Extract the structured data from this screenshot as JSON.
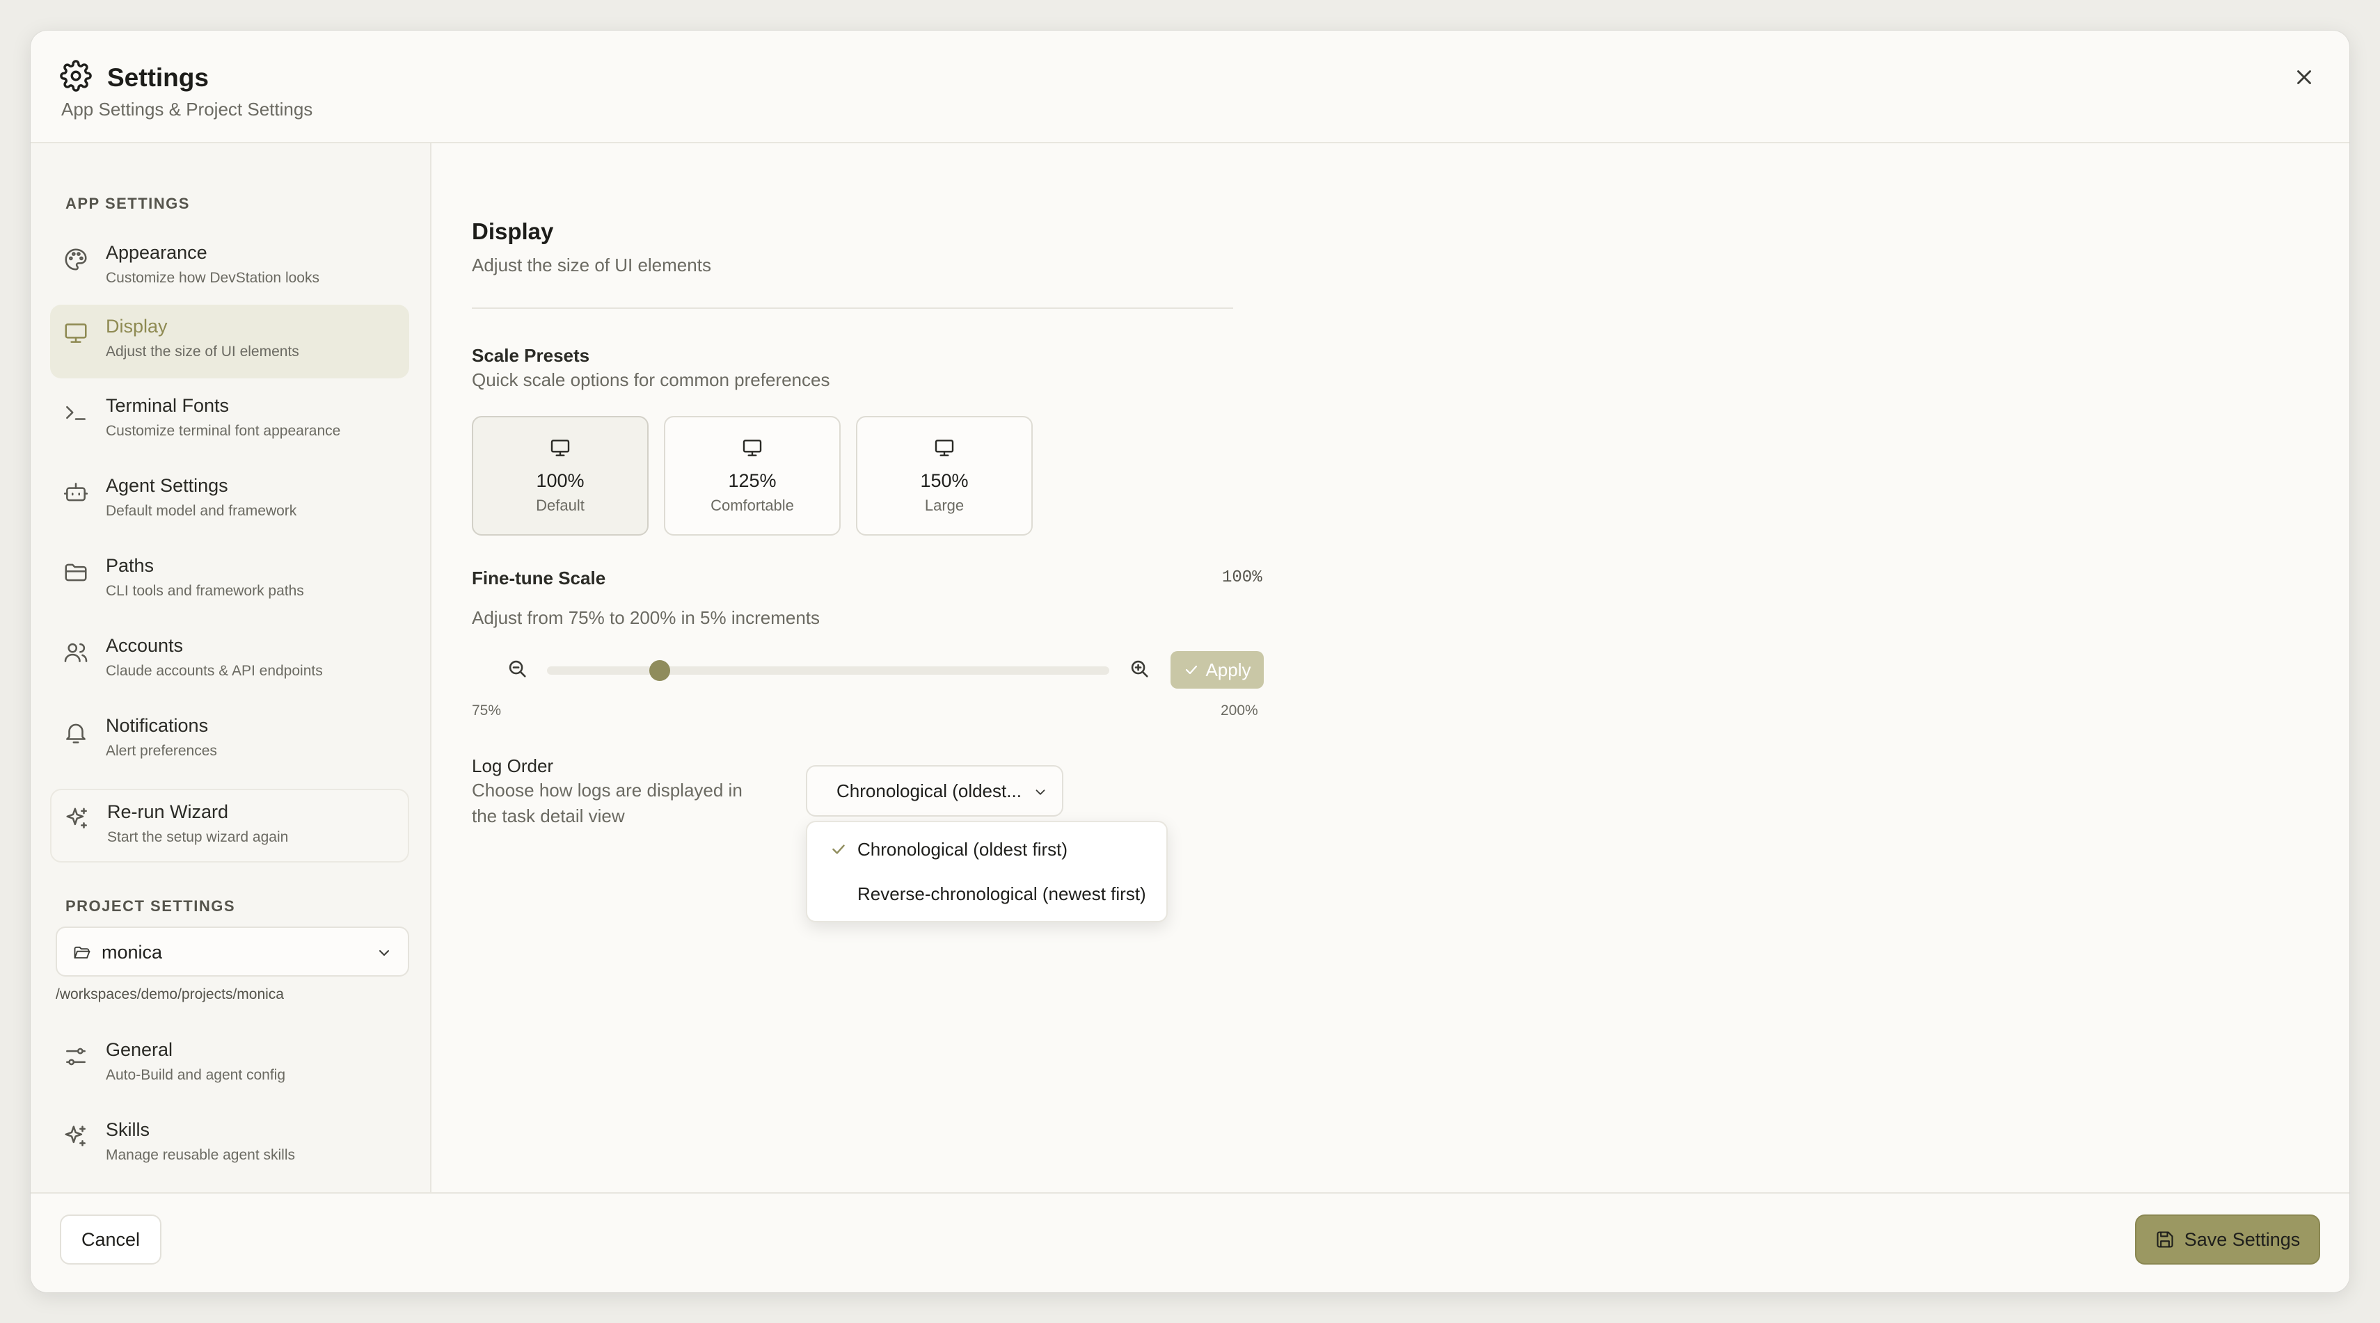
{
  "header": {
    "title": "Settings",
    "subtitle": "App Settings & Project Settings"
  },
  "sidebar": {
    "app_section_label": "APP SETTINGS",
    "items": [
      {
        "label": "Appearance",
        "desc": "Customize how DevStation looks",
        "icon": "palette-icon"
      },
      {
        "label": "Display",
        "desc": "Adjust the size of UI elements",
        "icon": "monitor-icon",
        "active": true
      },
      {
        "label": "Terminal Fonts",
        "desc": "Customize terminal font appearance",
        "icon": "terminal-icon"
      },
      {
        "label": "Agent Settings",
        "desc": "Default model and framework",
        "icon": "bot-icon"
      },
      {
        "label": "Paths",
        "desc": "CLI tools and framework paths",
        "icon": "folder-icon"
      },
      {
        "label": "Accounts",
        "desc": "Claude accounts & API endpoints",
        "icon": "users-icon"
      },
      {
        "label": "Notifications",
        "desc": "Alert preferences",
        "icon": "bell-icon"
      },
      {
        "label": "Re-run Wizard",
        "desc": "Start the setup wizard again",
        "icon": "sparkles-icon"
      }
    ],
    "project_section_label": "PROJECT SETTINGS",
    "project_select": {
      "value": "monica"
    },
    "project_path": "/workspaces/demo/projects/monica",
    "project_items": [
      {
        "label": "General",
        "desc": "Auto-Build and agent config",
        "icon": "sliders-icon"
      },
      {
        "label": "Skills",
        "desc": "Manage reusable agent skills",
        "icon": "sparkles-icon"
      }
    ]
  },
  "main": {
    "title": "Display",
    "subtitle": "Adjust the size of UI elements",
    "scale_presets": {
      "title": "Scale Presets",
      "desc": "Quick scale options for common preferences",
      "options": [
        {
          "value": "100%",
          "label": "Default",
          "selected": true
        },
        {
          "value": "125%",
          "label": "Comfortable"
        },
        {
          "value": "150%",
          "label": "Large"
        }
      ]
    },
    "fine_tune": {
      "title": "Fine-tune Scale",
      "current": "100%",
      "desc": "Adjust from 75% to 200% in 5% increments",
      "min_label": "75%",
      "max_label": "200%",
      "slider_fraction": 0.2,
      "apply_label": "Apply"
    },
    "log_order": {
      "title": "Log Order",
      "desc": "Choose how logs are displayed in the task detail view",
      "selected": "Chronological (oldest...",
      "options": [
        {
          "label": "Chronological (oldest first)",
          "checked": true
        },
        {
          "label": "Reverse-chronological (newest first)",
          "checked": false
        }
      ]
    }
  },
  "footer": {
    "cancel_label": "Cancel",
    "save_label": "Save Settings"
  },
  "colors": {
    "accent": "#9b9862",
    "accent_text": "#8e8a52",
    "active_bg": "#ecebde"
  }
}
